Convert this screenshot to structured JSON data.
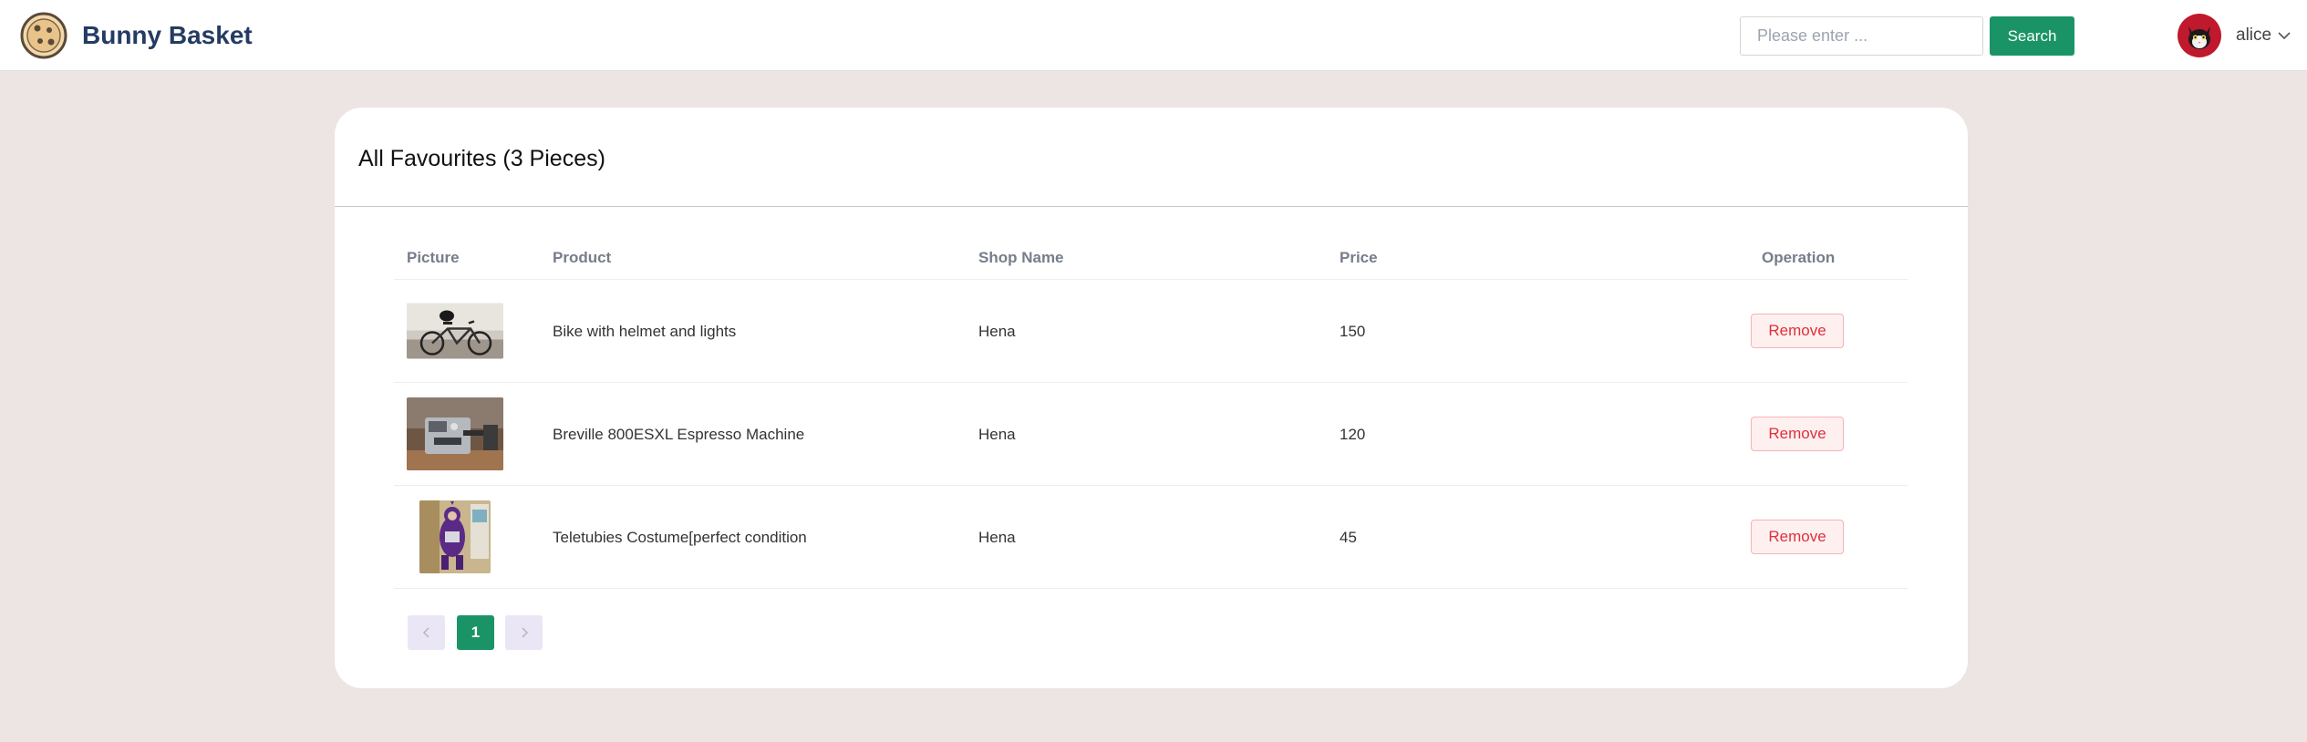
{
  "header": {
    "brand": "Bunny Basket",
    "search_placeholder": "Please enter ...",
    "search_label": "Search",
    "username": "alice"
  },
  "favourites": {
    "title": "All Favourites (3 Pieces)",
    "columns": {
      "picture": "Picture",
      "product": "Product",
      "shop": "Shop Name",
      "price": "Price",
      "operation": "Operation"
    },
    "rows": [
      {
        "product": "Bike with helmet and lights",
        "shop": "Hena",
        "price": "150",
        "action": "Remove"
      },
      {
        "product": "Breville 800ESXL Espresso Machine",
        "shop": "Hena",
        "price": "120",
        "action": "Remove"
      },
      {
        "product": "Teletubies Costume[perfect condition",
        "shop": "Hena",
        "price": "45",
        "action": "Remove"
      }
    ]
  },
  "pagination": {
    "current_page": "1"
  },
  "colors": {
    "primary": "#1a9467",
    "danger": "#e0303a",
    "page_bg": "#ece5e4"
  }
}
